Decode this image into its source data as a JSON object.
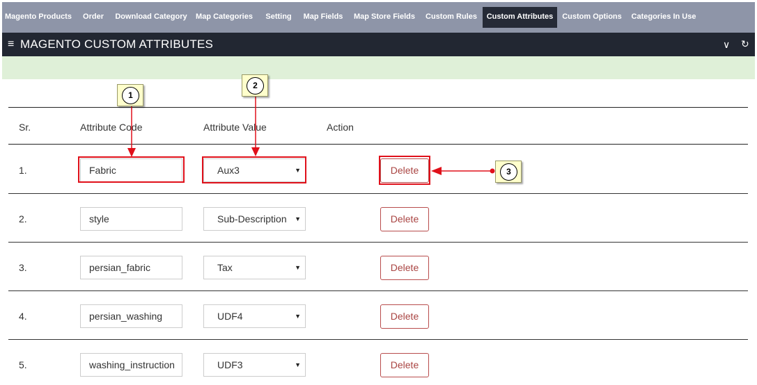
{
  "nav": {
    "tabs": [
      {
        "label": "Magento Products"
      },
      {
        "label": "Order"
      },
      {
        "label": "Download Category"
      },
      {
        "label": "Map Categories"
      },
      {
        "label": "Setting"
      },
      {
        "label": "Map Fields"
      },
      {
        "label": "Map Store Fields"
      },
      {
        "label": "Custom Rules"
      },
      {
        "label": "Custom Attributes",
        "active": true
      },
      {
        "label": "Custom Options"
      },
      {
        "label": "Categories In Use"
      }
    ]
  },
  "panel": {
    "menu_icon": "≡",
    "title": "MAGENTO CUSTOM ATTRIBUTES",
    "collapse_icon": "chevron-down-icon",
    "collapse_glyph": "∨",
    "refresh_icon": "refresh-icon",
    "refresh_glyph": "↻"
  },
  "table": {
    "headers": {
      "sr": "Sr.",
      "code": "Attribute Code",
      "value": "Attribute Value",
      "action": "Action"
    },
    "rows": [
      {
        "sr": "1.",
        "code": "Fabric",
        "value": "Aux3",
        "action": "Delete"
      },
      {
        "sr": "2.",
        "code": "style",
        "value": "Sub-Description",
        "action": "Delete"
      },
      {
        "sr": "3.",
        "code": "persian_fabric",
        "value": "Tax",
        "action": "Delete"
      },
      {
        "sr": "4.",
        "code": "persian_washing",
        "value": "UDF4",
        "action": "Delete"
      },
      {
        "sr": "5.",
        "code": "washing_instruction",
        "value": "UDF3",
        "action": "Delete"
      }
    ],
    "select_arrow": "▼"
  },
  "annotations": {
    "callouts": [
      "1",
      "2",
      "3"
    ],
    "highlight_color": "#e0101a"
  },
  "colors": {
    "nav_bg": "#8e95a8",
    "nav_active_bg": "#252a36",
    "header_bg": "#222732",
    "alert_bg": "#dff0d8",
    "delete_text": "#a94442"
  }
}
